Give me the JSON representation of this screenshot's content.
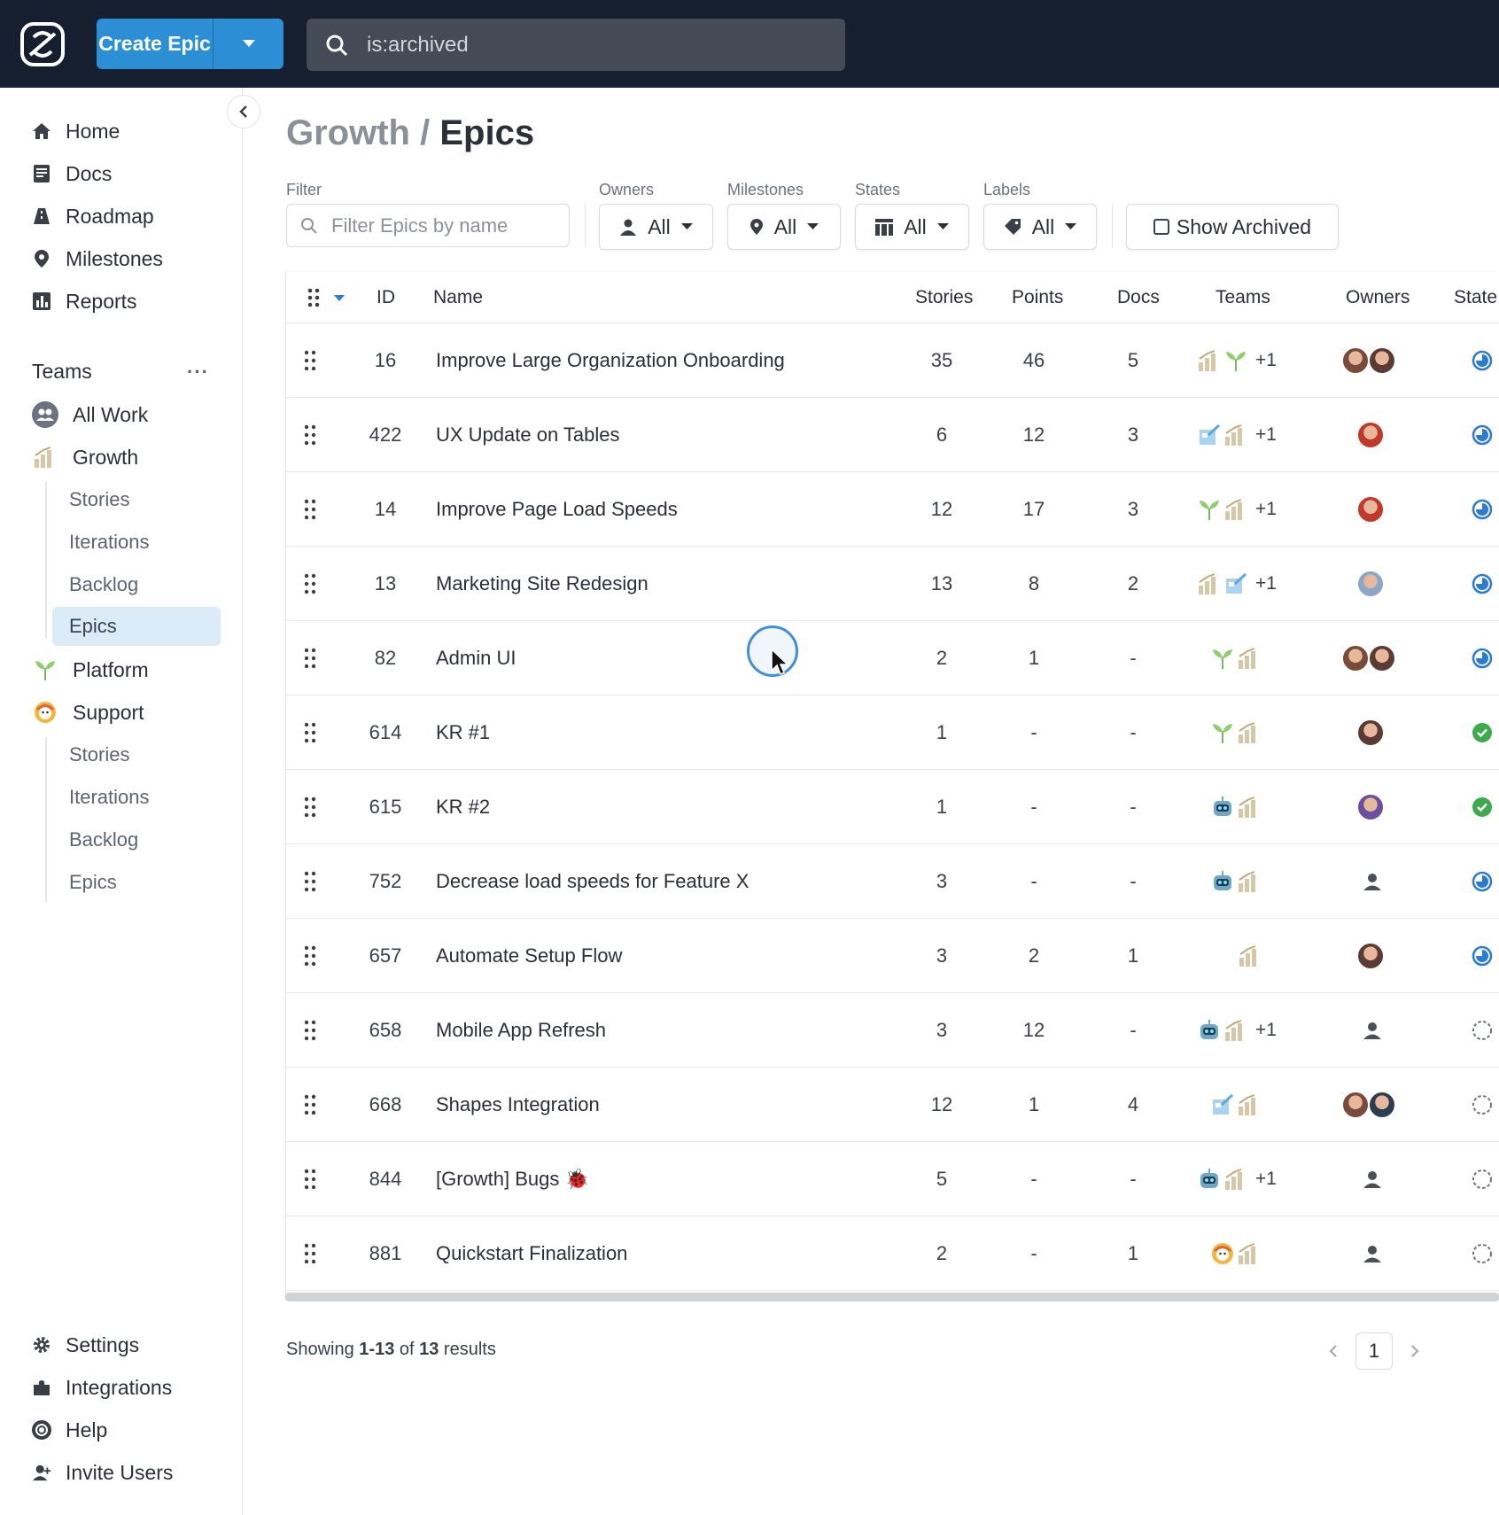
{
  "topbar": {
    "create_label": "Create Epic",
    "search_value": "is:archived"
  },
  "sidebar": {
    "nav": [
      {
        "label": "Home",
        "icon": "home-icon"
      },
      {
        "label": "Docs",
        "icon": "docs-icon"
      },
      {
        "label": "Roadmap",
        "icon": "roadmap-icon"
      },
      {
        "label": "Milestones",
        "icon": "milestone-icon"
      },
      {
        "label": "Reports",
        "icon": "reports-icon"
      }
    ],
    "teams_heading": "Teams",
    "teams_more": "···",
    "teams": [
      {
        "label": "All Work"
      },
      {
        "label": "Growth"
      },
      {
        "label": "Platform"
      },
      {
        "label": "Support"
      }
    ],
    "growth_sub": [
      "Stories",
      "Iterations",
      "Backlog",
      "Epics"
    ],
    "support_sub": [
      "Stories",
      "Iterations",
      "Backlog",
      "Epics"
    ],
    "bottom": [
      {
        "label": "Settings",
        "icon": "gear-icon"
      },
      {
        "label": "Integrations",
        "icon": "puzzle-icon"
      },
      {
        "label": "Help",
        "icon": "help-icon"
      },
      {
        "label": "Invite Users",
        "icon": "invite-user-icon"
      }
    ]
  },
  "page": {
    "crumb": "Growth",
    "sep": "/",
    "title": "Epics"
  },
  "filters": {
    "filter_label": "Filter",
    "filter_placeholder": "Filter Epics by name",
    "owners_label": "Owners",
    "owners_value": "All",
    "milestones_label": "Milestones",
    "milestones_value": "All",
    "states_label": "States",
    "states_value": "All",
    "labels_label": "Labels",
    "labels_value": "All",
    "show_archived": "Show Archived"
  },
  "table": {
    "columns": {
      "id": "ID",
      "name": "Name",
      "stories": "Stories",
      "points": "Points",
      "docs": "Docs",
      "teams": "Teams",
      "owners": "Owners",
      "state": "State"
    },
    "rows": [
      {
        "id": "16",
        "name": "Improve Large Organization Onboarding",
        "stories": "35",
        "points": "46",
        "docs": "5",
        "teams": [
          "growth",
          "platform"
        ],
        "extra": "+1",
        "owners": [
          "#7a4a3a",
          "#5b3b33"
        ],
        "state": "in-progress"
      },
      {
        "id": "422",
        "name": "UX Update on Tables",
        "stories": "6",
        "points": "12",
        "docs": "3",
        "teams": [
          "design",
          "growth"
        ],
        "extra": "+1",
        "owners": [
          "#c0392b"
        ],
        "state": "in-progress"
      },
      {
        "id": "14",
        "name": "Improve Page Load Speeds",
        "stories": "12",
        "points": "17",
        "docs": "3",
        "teams": [
          "platform",
          "growth"
        ],
        "extra": "+1",
        "owners": [
          "#c0392b"
        ],
        "state": "in-progress"
      },
      {
        "id": "13",
        "name": "Marketing Site Redesign",
        "stories": "13",
        "points": "8",
        "docs": "2",
        "teams": [
          "growth",
          "design"
        ],
        "extra": "+1",
        "owners": [
          "#8aa7c7"
        ],
        "state": "in-progress"
      },
      {
        "id": "82",
        "name": "Admin UI",
        "stories": "2",
        "points": "1",
        "docs": "-",
        "teams": [
          "platform",
          "growth"
        ],
        "extra": "",
        "owners": [
          "#7a4a3a",
          "#5b3b33"
        ],
        "state": "in-progress"
      },
      {
        "id": "614",
        "name": "KR #1",
        "stories": "1",
        "points": "-",
        "docs": "-",
        "teams": [
          "platform",
          "growth"
        ],
        "extra": "",
        "owners": [
          "#5b3b33"
        ],
        "state": "done"
      },
      {
        "id": "615",
        "name": "KR #2",
        "stories": "1",
        "points": "-",
        "docs": "-",
        "teams": [
          "robot",
          "growth"
        ],
        "extra": "",
        "owners": [
          "#6b4fa0"
        ],
        "state": "done"
      },
      {
        "id": "752",
        "name": "Decrease load speeds for Feature X",
        "stories": "3",
        "points": "-",
        "docs": "-",
        "teams": [
          "robot",
          "growth"
        ],
        "extra": "",
        "owners": [
          "none"
        ],
        "state": "in-progress"
      },
      {
        "id": "657",
        "name": "Automate Setup Flow",
        "stories": "3",
        "points": "2",
        "docs": "1",
        "teams": [
          "growth"
        ],
        "extra": "",
        "owners": [
          "#5b3b33"
        ],
        "state": "in-progress"
      },
      {
        "id": "658",
        "name": "Mobile App Refresh",
        "stories": "3",
        "points": "12",
        "docs": "-",
        "teams": [
          "robot",
          "growth"
        ],
        "extra": "+1",
        "owners": [
          "none"
        ],
        "state": "unstarted"
      },
      {
        "id": "668",
        "name": "Shapes Integration",
        "stories": "12",
        "points": "1",
        "docs": "4",
        "teams": [
          "design",
          "growth"
        ],
        "extra": "",
        "owners": [
          "#7a4a3a",
          "#2c3e50"
        ],
        "state": "unstarted"
      },
      {
        "id": "844",
        "name": "[Growth] Bugs 🐞",
        "stories": "5",
        "points": "-",
        "docs": "-",
        "teams": [
          "robot",
          "growth"
        ],
        "extra": "+1",
        "owners": [
          "none"
        ],
        "state": "unstarted"
      },
      {
        "id": "881",
        "name": "Quickstart Finalization",
        "stories": "2",
        "points": "-",
        "docs": "1",
        "teams": [
          "support",
          "growth"
        ],
        "extra": "",
        "owners": [
          "none"
        ],
        "state": "unstarted"
      }
    ]
  },
  "footer": {
    "showing_prefix": "Showing ",
    "showing_range": "1-13",
    "showing_mid": " of ",
    "showing_total": "13",
    "showing_suffix": " results",
    "page": "1"
  },
  "colors": {
    "accent": "#2c8fd6",
    "topbar": "#161f30",
    "active_nav": "#dcebf8",
    "done": "#3cab4b",
    "in_progress": "#2c7bd1"
  }
}
